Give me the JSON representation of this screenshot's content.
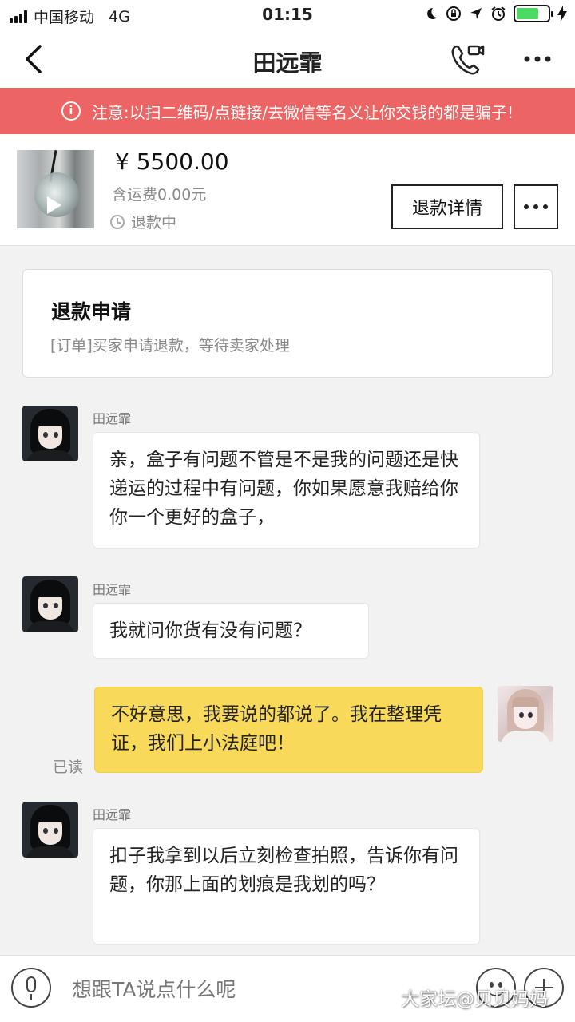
{
  "status_bar": {
    "carrier": "中国移动",
    "network": "4G",
    "time": "01:15"
  },
  "nav": {
    "title": "田远霏"
  },
  "warning": {
    "text": "注意:以扫二维码/点链接/去微信等名义让你交钱的都是骗子!"
  },
  "product": {
    "price": "¥ 5500.00",
    "shipping": "含运费0.00元",
    "status": "退款中",
    "refund_button": "退款详情"
  },
  "refund_card": {
    "title": "退款申请",
    "text": "[订单]买家申请退款，等待卖家处理"
  },
  "messages": [
    {
      "sender": "田远霏",
      "text": "亲，盒子有问题不管是不是我的问题还是快递运的过程中有问题，你如果愿意我赔给你你一个更好的盒子，",
      "mine": false
    },
    {
      "sender": "田远霏",
      "text": "我就问你货有没有问题？",
      "mine": false
    },
    {
      "sender": "",
      "text": "不好意思，我要说的都说了。我在整理凭证，我们上小法庭吧！",
      "mine": true,
      "read_label": "已读"
    },
    {
      "sender": "田远霏",
      "text": "扣子我拿到以后立刻检查拍照，告诉你有问题，你那上面的划痕是我划的吗？",
      "mine": false
    }
  ],
  "input": {
    "placeholder": "想跟TA说点什么呢"
  },
  "watermark": "大家坛@贝贝妈妈",
  "colors": {
    "warning_bg": "#ec6464",
    "my_bubble": "#f8d95a",
    "chat_bg": "#f2f2f2"
  },
  "icons": [
    "back-chevron-icon",
    "video-call-icon",
    "more-dots-icon",
    "warning-circle-icon",
    "play-icon",
    "clock-icon",
    "mic-icon",
    "emoji-icon",
    "plus-icon"
  ]
}
